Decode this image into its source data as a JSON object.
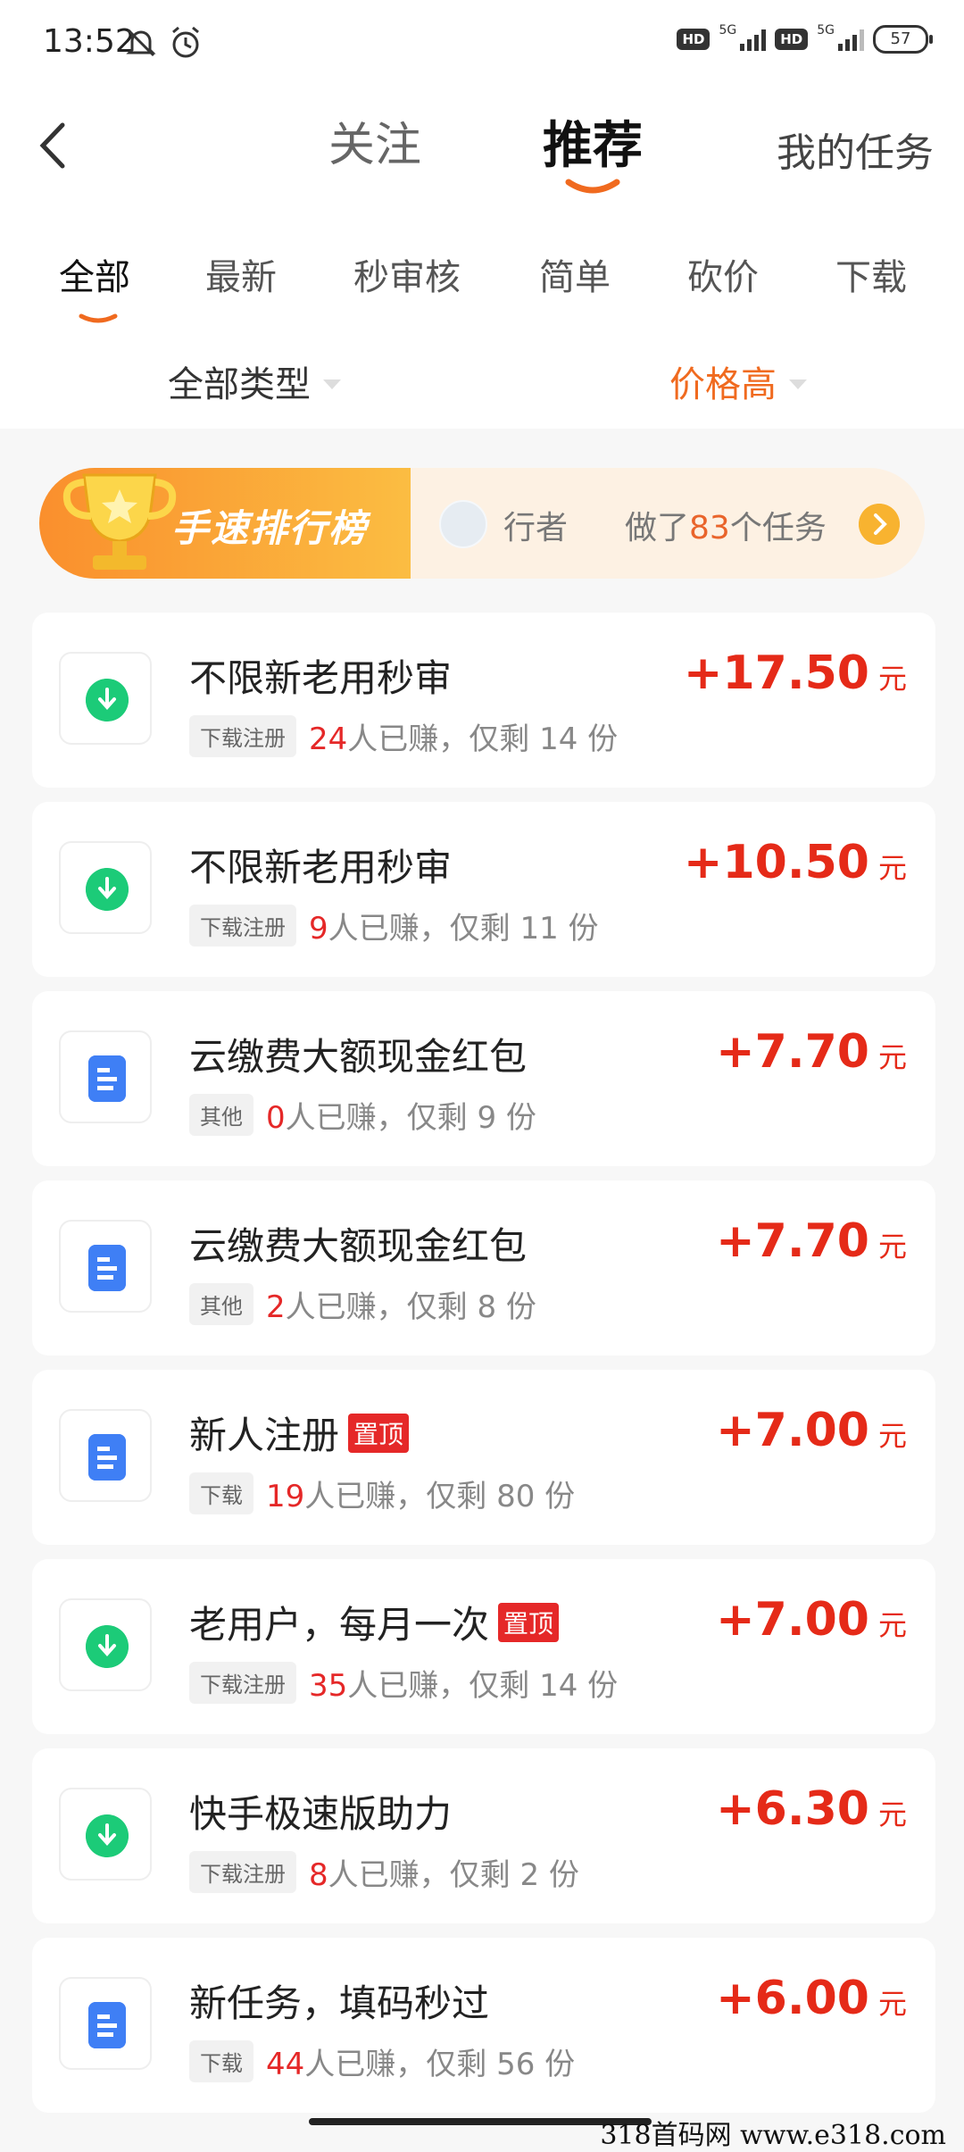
{
  "status_bar": {
    "time": "13:52",
    "network": "5G",
    "battery": "57",
    "hd_label": "HD"
  },
  "nav": {
    "back_label": "",
    "tabs": [
      "关注",
      "推荐",
      "我的任务"
    ]
  },
  "subtabs": [
    "全部",
    "最新",
    "秒审核",
    "简单",
    "砍价",
    "下载"
  ],
  "filters": {
    "type": "全部类型",
    "sort": "价格高"
  },
  "rank_banner": {
    "title": "手速排行榜",
    "user": "行者",
    "did_prefix": "做了",
    "count": "83",
    "did_suffix": "个任务"
  },
  "tasks": [
    {
      "title": "不限新老用秒审",
      "tag": "下载注册",
      "done": "24",
      "done_suffix": "人已赚，仅剩 14 份",
      "price": "+17.50",
      "unit": "元",
      "icon": "download-icon",
      "pinned": false
    },
    {
      "title": "不限新老用秒审",
      "tag": "下载注册",
      "done": "9",
      "done_suffix": "人已赚，仅剩 11 份",
      "price": "+10.50",
      "unit": "元",
      "icon": "download-icon",
      "pinned": false
    },
    {
      "title": "云缴费大额现金红包",
      "tag": "其他",
      "done": "0",
      "done_suffix": "人已赚，仅剩 9 份",
      "price": "+7.70",
      "unit": "元",
      "icon": "document-icon",
      "pinned": false
    },
    {
      "title": "云缴费大额现金红包",
      "tag": "其他",
      "done": "2",
      "done_suffix": "人已赚，仅剩 8 份",
      "price": "+7.70",
      "unit": "元",
      "icon": "document-icon",
      "pinned": false
    },
    {
      "title": "新人注册",
      "tag": "下载",
      "done": "19",
      "done_suffix": "人已赚，仅剩 80 份",
      "price": "+7.00",
      "unit": "元",
      "icon": "document-icon",
      "pinned": true,
      "pin_label": "置顶"
    },
    {
      "title": "老用户，每月一次",
      "tag": "下载注册",
      "done": "35",
      "done_suffix": "人已赚，仅剩 14 份",
      "price": "+7.00",
      "unit": "元",
      "icon": "download-icon",
      "pinned": true,
      "pin_label": "置顶"
    },
    {
      "title": "快手极速版助力",
      "tag": "下载注册",
      "done": "8",
      "done_suffix": "人已赚，仅剩 2 份",
      "price": "+6.30",
      "unit": "元",
      "icon": "download-icon",
      "pinned": false
    },
    {
      "title": "新任务，填码秒过",
      "tag": "下载",
      "done": "44",
      "done_suffix": "人已赚，仅剩 56 份",
      "price": "+6.00",
      "unit": "元",
      "icon": "document-icon",
      "pinned": false
    }
  ],
  "watermark": "318首码网  www.e318.com",
  "colors": {
    "accent": "#f06a1f",
    "price": "#e52a18",
    "download": "#1ccb78",
    "document": "#3f7ff5"
  }
}
